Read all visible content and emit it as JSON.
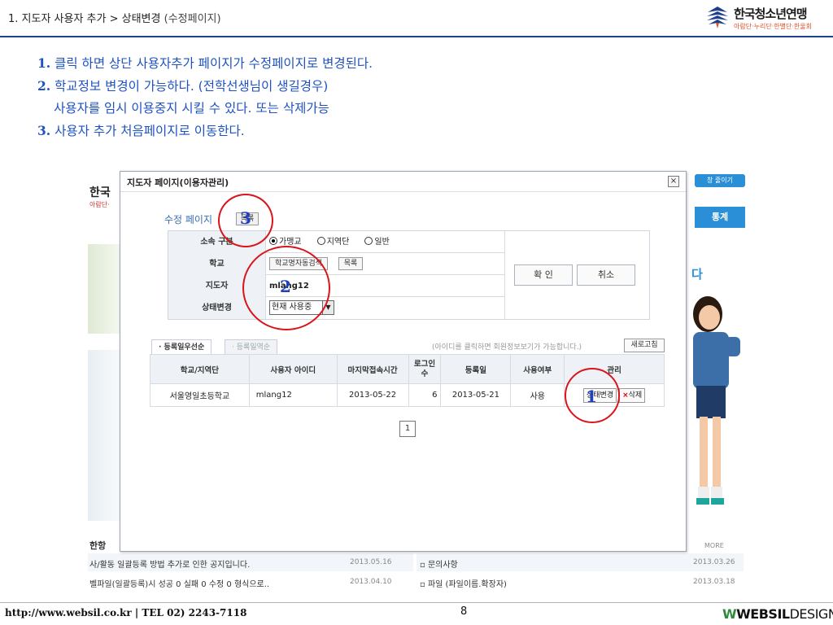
{
  "slide": {
    "title": "1. 지도자 사용자 추가  > 상태변경",
    "subtitle": " (수정페이지)"
  },
  "logo": {
    "name": "한국청소년연맹",
    "tagline": "아람단·누리단·한별단·한울회"
  },
  "steps": [
    {
      "num": "1.",
      "text": " 클릭 하면 상단 사용자추가 페이지가 수정페이지로 변경된다."
    },
    {
      "num": "2.",
      "text": " 학교정보 변경이 가능하다. (전학선생님이 생길경우)"
    },
    {
      "num": "",
      "text": "사용자를 임시 이용중지 시킬 수 있다. 또는 삭제가능"
    },
    {
      "num": "3.",
      "text": " 사용자 추가 처음페이지로 이동한다."
    }
  ],
  "background_site": {
    "logo_text": "한국",
    "logo_sub": "아람단·",
    "btn_top": "창 줄이기",
    "btn_stats": "통계",
    "side_char": "다",
    "notice_title": "한항",
    "more": "MORE",
    "rows_left": [
      {
        "text": "사/활동 일괄등록 방법 추가로 인한 공지입니다.",
        "date": "2013.05.16"
      },
      {
        "text": "벨파일(일괄등록)시 성공 0 실패 0 수정 0 형식으로..",
        "date": "2013.04.10"
      }
    ],
    "rows_right": [
      {
        "text": "▫ 문의사항",
        "date": "2013.03.26"
      },
      {
        "text": "▫ 파일 (파일이름.확장자)",
        "date": "2013.03.18"
      }
    ]
  },
  "popup": {
    "title": "지도자 페이지(이용자관리)",
    "close": "×",
    "edit_heading": "수정 페이지",
    "list_button": "목록",
    "form": {
      "affiliation_label": "소속 구분",
      "affiliation_options": [
        "가맹교",
        "지역단",
        "일반"
      ],
      "affiliation_selected": "가맹교",
      "school_label": "학교",
      "school_search_button": "학교명자동검색",
      "school_list_button": "목록",
      "leader_label": "지도자",
      "leader_value": "mlang12",
      "status_label": "상태변경",
      "status_value": "현재 사용중"
    },
    "confirm_button": "확  인",
    "cancel_button": "취소",
    "tabs": [
      "· 등록일우선순",
      "· 등록일역순"
    ],
    "hint": "(아이디를 클릭하면 회원정보보기가 가능합니다.)",
    "refresh_button": "새로고침",
    "table": {
      "headers": [
        "학교/지역단",
        "사용자 아이디",
        "마지막접속시간",
        "로그인\n수",
        "등록일",
        "사용여부",
        "관리"
      ],
      "row": {
        "school": "서울영일초등학교",
        "user_id": "mlang12",
        "last_login": "2013-05-22",
        "login_count": "6",
        "registered": "2013-05-21",
        "in_use": "사용",
        "status_button": "상태변경",
        "delete_button": "삭제",
        "delete_mark": "×"
      }
    },
    "pagination": "1"
  },
  "annotations": [
    "1",
    "2",
    "3"
  ],
  "footer": {
    "url": "http://www.websil.co.kr  |  TEL 02) 2243-7118",
    "page": "8",
    "brand_bold": "WEBSIL",
    "brand_light": "DESIGN"
  },
  "colors": {
    "accent_blue": "#1e52c2",
    "annotation_red": "#d9141b",
    "header_line": "#1e3f8f"
  }
}
